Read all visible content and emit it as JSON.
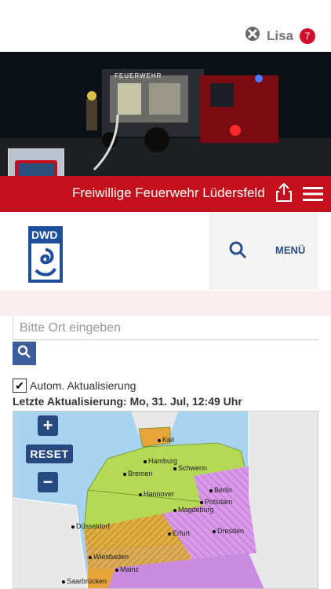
{
  "header": {
    "user_name": "Lisa",
    "notification_count": "7"
  },
  "banner": {
    "title": "Freiwillige Feuerwehr Lüdersfeld",
    "truck_label": "FEUERWEHR"
  },
  "dwd": {
    "logo_text": "DWD",
    "menu_label": "MENÜ"
  },
  "search": {
    "placeholder": "Bitte Ort eingeben"
  },
  "update": {
    "auto_label": "Autom. Aktualisierung",
    "last_update": "Letzte Aktualisierung: Mo, 31. Jul, 12:49 Uhr"
  },
  "map": {
    "reset_label": "RESET",
    "zoom_in_label": "+",
    "zoom_out_label": "−",
    "cities": [
      "Kiel",
      "Hamburg",
      "Schwerin",
      "Bremen",
      "Hannover",
      "Berlin",
      "Potsdam",
      "Magdeburg",
      "Düsseldorf",
      "Erfurt",
      "Dresden",
      "Wiesbaden",
      "Mainz",
      "Saarbrücken"
    ]
  },
  "colors": {
    "brand_red": "#c4101d",
    "dwd_blue": "#1d4f9c",
    "warning_green": "#b5d957",
    "warning_orange": "#e7a53a",
    "warning_purple": "#c98ce0"
  }
}
